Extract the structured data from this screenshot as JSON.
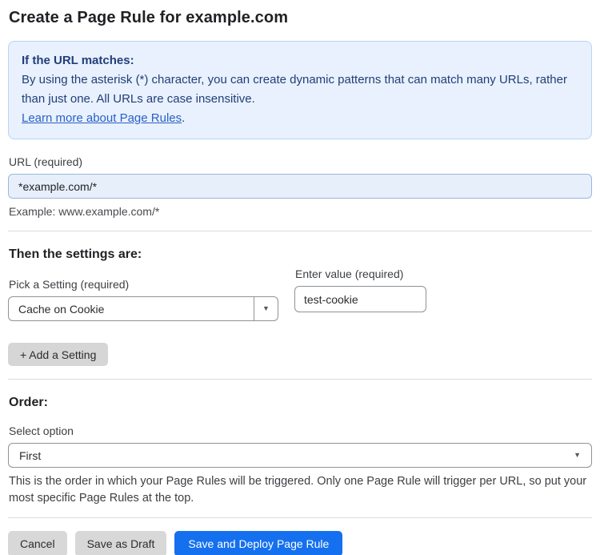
{
  "page": {
    "title": "Create a Page Rule for example.com"
  },
  "info_box": {
    "heading": "If the URL matches:",
    "body": "By using the asterisk (*) character, you can create dynamic patterns that can match many URLs, rather than just one. All URLs are case insensitive.",
    "link_label": "Learn more about Page Rules",
    "link_suffix": "."
  },
  "url_field": {
    "label": "URL (required)",
    "value": "*example.com/*",
    "example": "Example: www.example.com/*"
  },
  "settings": {
    "heading": "Then the settings are:",
    "setting_select": {
      "label": "Pick a Setting (required)",
      "selected_value": "Cache on Cookie"
    },
    "value_field": {
      "label": "Enter value (required)",
      "value": "test-cookie"
    },
    "add_button_label": "+ Add a Setting"
  },
  "order": {
    "heading": "Order:",
    "select_label": "Select option",
    "selected_value": "First",
    "help_text": "This is the order in which your Page Rules will be triggered. Only one Page Rule will trigger per URL, so put your most specific Page Rules at the top."
  },
  "actions": {
    "cancel_label": "Cancel",
    "save_draft_label": "Save as Draft",
    "save_deploy_label": "Save and Deploy Page Rule"
  },
  "icons": {
    "dropdown_arrow": "▼"
  },
  "colors": {
    "info_background": "#e8f1fd",
    "info_border": "#b9d4f3",
    "info_text": "#223e78",
    "link_blue": "#2b60c8",
    "url_input_background": "#e7effb",
    "url_input_border": "#9db6dd",
    "primary_button_blue": "#1570ef",
    "gray_button": "#d8d8d8"
  }
}
